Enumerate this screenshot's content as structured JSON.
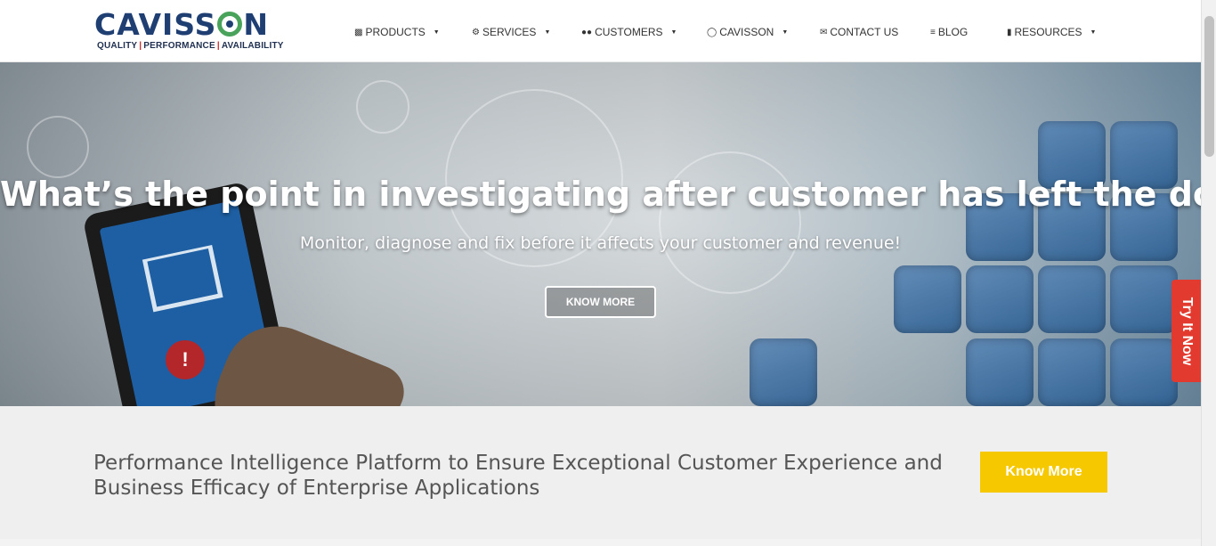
{
  "brand": {
    "name_part1": "CAVISS",
    "name_part2": "N",
    "tag1": "QUALITY",
    "tag2": "PERFORMANCE",
    "tag3": "AVAILABILITY",
    "tag_sep": "|"
  },
  "nav": {
    "products": "PRODUCTS",
    "services": "SERVICES",
    "customers": "CUSTOMERS",
    "cavisson": "CAVISSON",
    "contact": "CONTACT US",
    "blog": "BLOG",
    "resources": "RESOURCES",
    "caret": "▼"
  },
  "hero": {
    "title": "What’s the point in investigating after customer has left the door?",
    "subtitle": "Monitor, diagnose and fix before it affects your customer and revenue!",
    "button": "KNOW MORE",
    "alert_mark": "!"
  },
  "side_tab": {
    "label": "Try It Now"
  },
  "band": {
    "text": "Performance Intelligence Platform to Ensure Exceptional Customer Experience and Business Efficacy of Enterprise Applications",
    "button": "Know More"
  },
  "colors": {
    "brand_blue": "#1f3f73",
    "brand_green": "#4aa35a",
    "accent_red": "#e23a2e",
    "cta_yellow": "#f5c800"
  }
}
